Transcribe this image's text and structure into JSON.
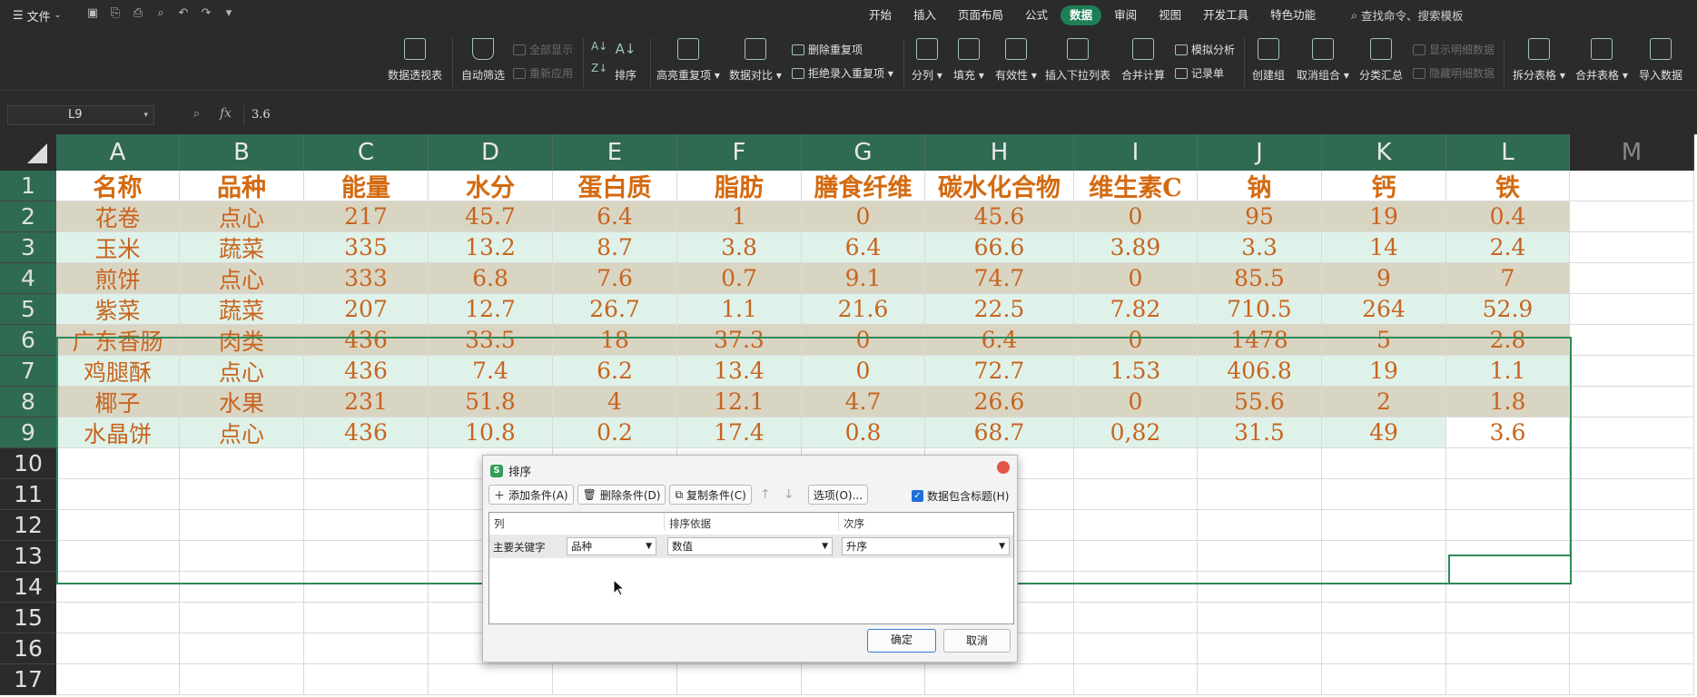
{
  "menubar": {
    "file_label": "文件",
    "tabs": [
      "开始",
      "插入",
      "页面布局",
      "公式",
      "数据",
      "审阅",
      "视图",
      "开发工具",
      "特色功能"
    ],
    "active_tab": "数据",
    "search_label": "查找命令、搜索模板"
  },
  "ribbon": {
    "pivot": "数据透视表",
    "autofilter": "自动筛选",
    "show_all": "全部显示",
    "reapply": "重新应用",
    "sort": "排序",
    "highlight_dup": "高亮重复项",
    "data_compare": "数据对比",
    "delete_dup": "删除重复项",
    "reject_dup": "拒绝录入重复项",
    "split": "分列",
    "fill": "填充",
    "validity": "有效性",
    "dropdown_list": "插入下拉列表",
    "merge_calc": "合并计算",
    "simulate": "模拟分析",
    "record": "记录单",
    "create_group": "创建组",
    "ungroup": "取消组合",
    "subtotal": "分类汇总",
    "show_detail": "显示明细数据",
    "hide_detail": "隐藏明细数据",
    "split_table": "拆分表格",
    "merge_table": "合并表格",
    "import_data": "导入数据"
  },
  "formula_bar": {
    "name_box": "L9",
    "fx": "fx",
    "value": "3.6"
  },
  "sheet": {
    "columns": [
      "A",
      "B",
      "C",
      "D",
      "E",
      "F",
      "G",
      "H",
      "I",
      "J",
      "K",
      "L",
      "M"
    ],
    "row_numbers": [
      "1",
      "2",
      "3",
      "4",
      "5",
      "6",
      "7",
      "8",
      "9",
      "10",
      "11",
      "12",
      "13",
      "14",
      "15",
      "16",
      "17"
    ],
    "header": [
      "名称",
      "品种",
      "能量",
      "水分",
      "蛋白质",
      "脂肪",
      "膳食纤维",
      "碳水化合物",
      "维生素C",
      "钠",
      "钙",
      "铁"
    ],
    "rows": [
      [
        "花卷",
        "点心",
        "217",
        "45.7",
        "6.4",
        "1",
        "0",
        "45.6",
        "0",
        "95",
        "19",
        "0.4"
      ],
      [
        "玉米",
        "蔬菜",
        "335",
        "13.2",
        "8.7",
        "3.8",
        "6.4",
        "66.6",
        "3.89",
        "3.3",
        "14",
        "2.4"
      ],
      [
        "煎饼",
        "点心",
        "333",
        "6.8",
        "7.6",
        "0.7",
        "9.1",
        "74.7",
        "0",
        "85.5",
        "9",
        "7"
      ],
      [
        "紫菜",
        "蔬菜",
        "207",
        "12.7",
        "26.7",
        "1.1",
        "21.6",
        "22.5",
        "7.82",
        "710.5",
        "264",
        "52.9"
      ],
      [
        "广东香肠",
        "肉类",
        "436",
        "33.5",
        "18",
        "37.3",
        "0",
        "6.4",
        "0",
        "1478",
        "5",
        "2.8"
      ],
      [
        "鸡腿酥",
        "点心",
        "436",
        "7.4",
        "6.2",
        "13.4",
        "0",
        "72.7",
        "1.53",
        "406.8",
        "19",
        "1.1"
      ],
      [
        "椰子",
        "水果",
        "231",
        "51.8",
        "4",
        "12.1",
        "4.7",
        "26.6",
        "0",
        "55.6",
        "2",
        "1.8"
      ],
      [
        "水晶饼",
        "点心",
        "436",
        "10.8",
        "0.2",
        "17.4",
        "0.8",
        "68.7",
        "0,82",
        "31.5",
        "49",
        "3.6"
      ]
    ],
    "row_colors": {
      "even": "#d9d5c3",
      "odd": "#dff2ea"
    }
  },
  "dialog": {
    "title": "排序",
    "add_condition": "添加条件(A)",
    "delete_condition": "删除条件(D)",
    "copy_condition": "复制条件(C)",
    "options": "选项(O)...",
    "has_header": "数据包含标题(H)",
    "col_header_column": "列",
    "col_header_basis": "排序依据",
    "col_header_order": "次序",
    "primary_key_label": "主要关键字",
    "primary_key_value": "品种",
    "basis_value": "数值",
    "order_value": "升序",
    "ok": "确定",
    "cancel": "取消"
  }
}
